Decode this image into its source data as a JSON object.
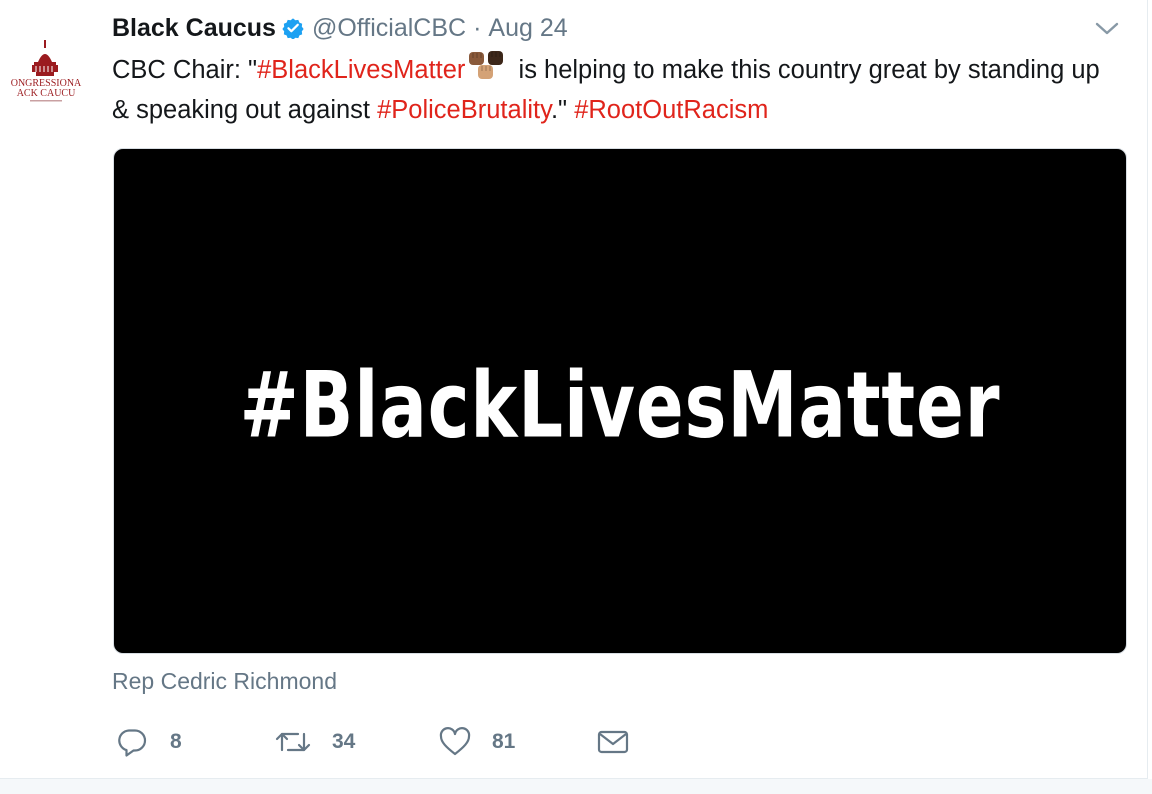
{
  "tweet": {
    "author_name": "Black Caucus",
    "handle": "@OfficialCBC",
    "separator": "·",
    "date": "Aug 24",
    "text": {
      "part1": "CBC Chair: \"",
      "hashtag1": "#BlackLivesMatter",
      "part2": " is helping to make this country great by standing up & speaking out against ",
      "hashtag2": "#PoliceBrutality",
      "part3": ".\" ",
      "hashtag3": "#RootOutRacism"
    },
    "media_text": "#BlackLivesMatter",
    "tagged_user": "Rep Cedric Richmond",
    "avatar_text": {
      "line1": "ONGRESSIONA",
      "line2": "ACK CAUCU"
    }
  },
  "actions": {
    "reply_count": "8",
    "retweet_count": "34",
    "like_count": "81"
  },
  "icons": {
    "verified": "verified-badge-icon",
    "caret": "chevron-down-icon",
    "reply": "reply-icon",
    "retweet": "retweet-icon",
    "like": "heart-icon",
    "dm": "envelope-icon"
  },
  "colors": {
    "hashtag": "#e0241b",
    "verified": "#1da1f2",
    "muted": "#657786",
    "text": "#14171a",
    "avatar_brand": "#9b1b1f"
  }
}
